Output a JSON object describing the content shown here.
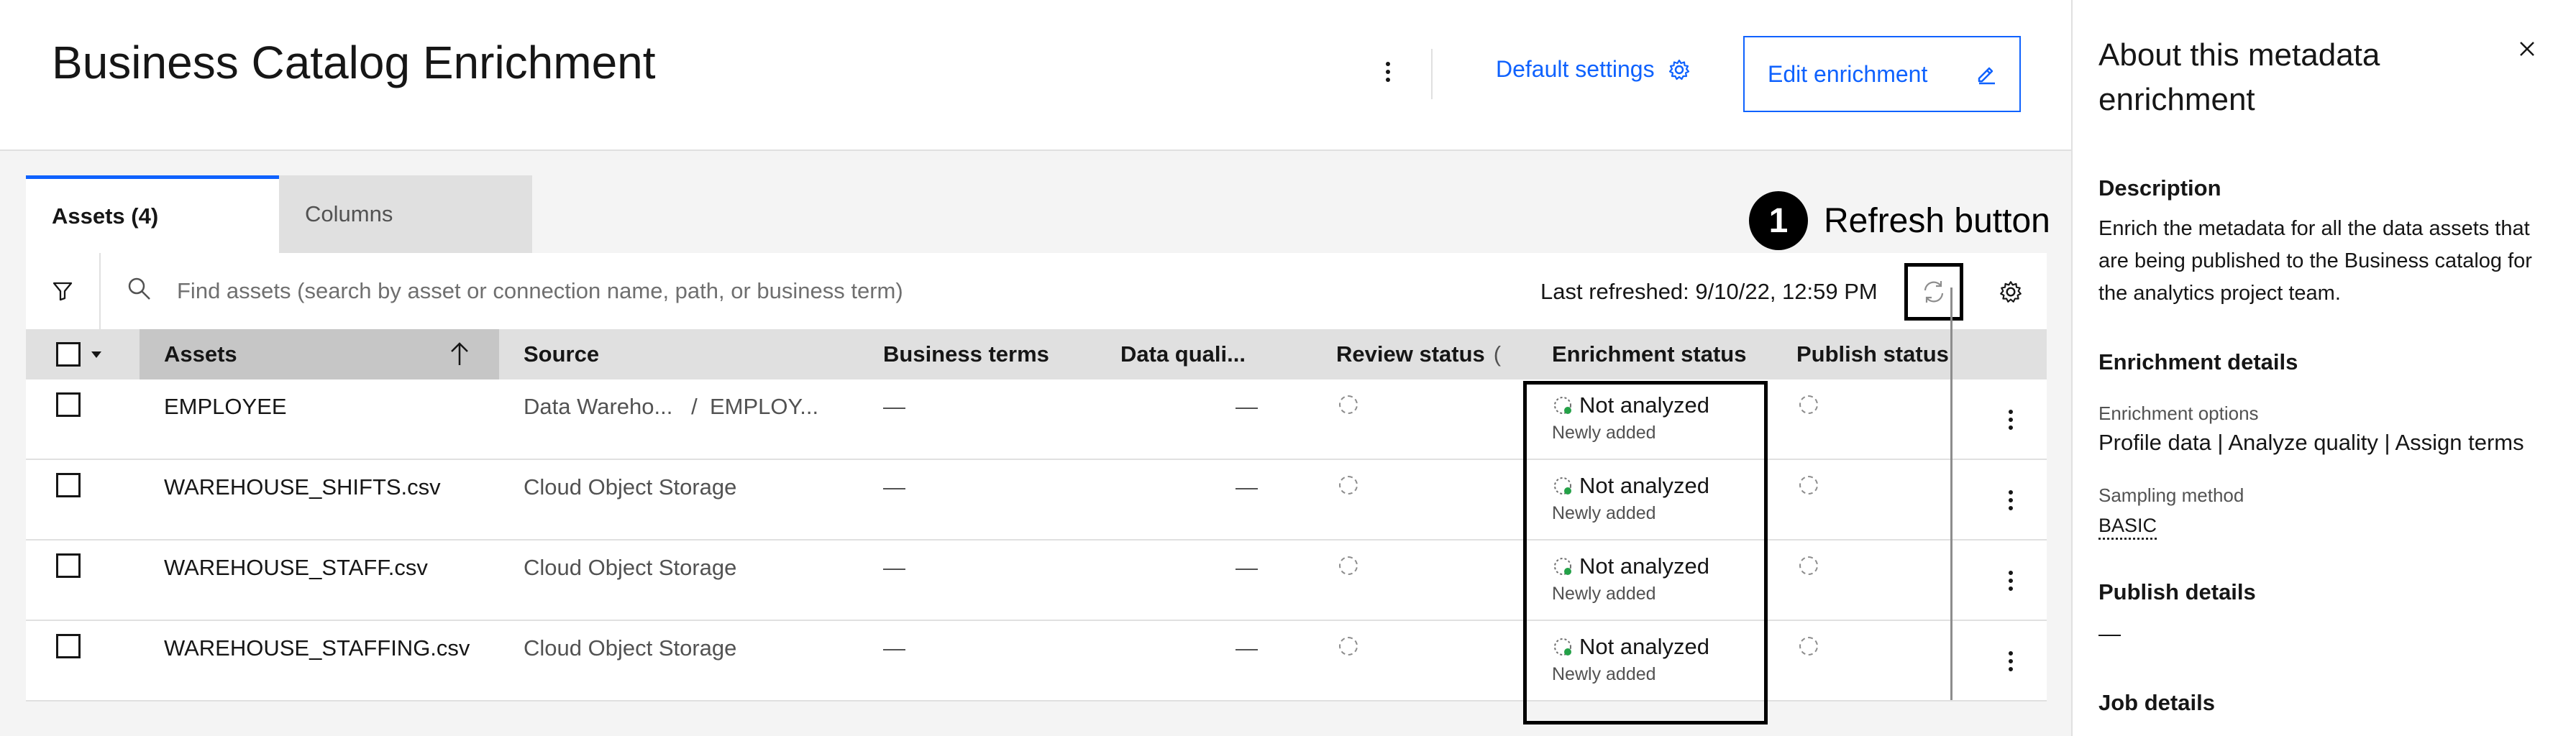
{
  "header": {
    "title": "Business Catalog Enrichment",
    "default_settings_label": "Default settings",
    "edit_enrichment_label": "Edit enrichment"
  },
  "tabs": [
    {
      "label": "Assets (4)",
      "selected": true
    },
    {
      "label": "Columns",
      "selected": false
    }
  ],
  "annotation": {
    "number": "1",
    "text": "Refresh button"
  },
  "toolbar": {
    "search_placeholder": "Find assets (search by asset or connection name, path, or business term)",
    "last_refreshed": "Last refreshed: 9/10/22, 12:59 PM"
  },
  "table": {
    "columns": [
      "Assets",
      "Source",
      "Business terms",
      "Data quali...",
      "Review status",
      "Enrichment status",
      "Publish status"
    ],
    "rows": [
      {
        "asset": "EMPLOYEE",
        "source": "Data Wareho...   /  EMPLOY...",
        "business_terms": "—",
        "data_quality": "—",
        "enrichment_status": "Not analyzed",
        "enrichment_sub": "Newly added"
      },
      {
        "asset": "WAREHOUSE_SHIFTS.csv",
        "source": "Cloud Object Storage",
        "business_terms": "—",
        "data_quality": "—",
        "enrichment_status": "Not analyzed",
        "enrichment_sub": "Newly added"
      },
      {
        "asset": "WAREHOUSE_STAFF.csv",
        "source": "Cloud Object Storage",
        "business_terms": "—",
        "data_quality": "—",
        "enrichment_status": "Not analyzed",
        "enrichment_sub": "Newly added"
      },
      {
        "asset": "WAREHOUSE_STAFFING.csv",
        "source": "Cloud Object Storage",
        "business_terms": "—",
        "data_quality": "—",
        "enrichment_status": "Not analyzed",
        "enrichment_sub": "Newly added"
      }
    ]
  },
  "panel": {
    "title": "About this metadata enrichment",
    "description_heading": "Description",
    "description": "Enrich the metadata for all the data assets that are being published to the Business catalog for the analytics project team.",
    "enrichment_details_heading": "Enrichment details",
    "enrichment_options_label": "Enrichment options",
    "enrichment_options_value": "Profile data | Analyze quality | Assign terms",
    "sampling_method_label": "Sampling method",
    "sampling_method_value": "BASIC",
    "publish_details_heading": "Publish details",
    "publish_details_value": "—",
    "job_details_heading": "Job details"
  },
  "colors": {
    "accent": "#0f62fe",
    "text": "#161616",
    "header_bg": "#e0e0e0"
  },
  "icons": [
    "overflow-menu-icon",
    "settings-icon",
    "edit-icon",
    "filter-icon",
    "search-icon",
    "refresh-icon",
    "sort-ascending-icon",
    "pending-icon",
    "close-icon"
  ]
}
